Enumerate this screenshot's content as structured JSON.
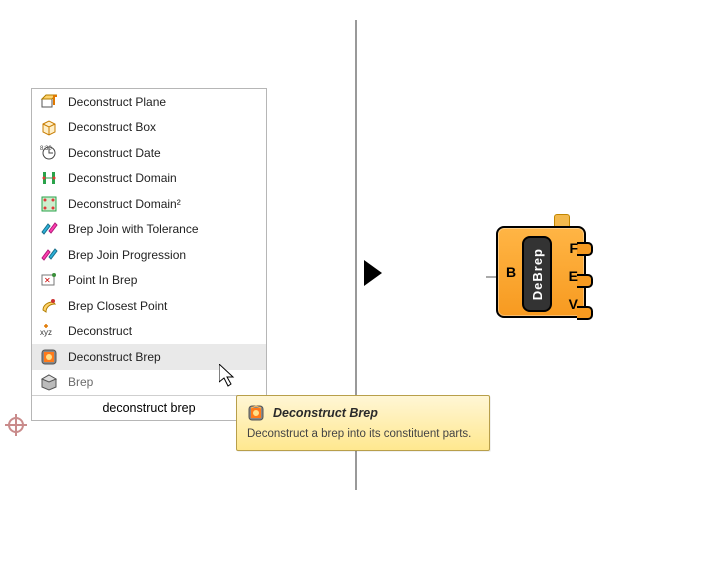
{
  "menu": {
    "items": [
      {
        "icon": "deconstruct-plane-icon",
        "label": "Deconstruct Plane"
      },
      {
        "icon": "deconstruct-box-icon",
        "label": "Deconstruct Box"
      },
      {
        "icon": "deconstruct-date-icon",
        "label": "Deconstruct Date"
      },
      {
        "icon": "deconstruct-domain-icon",
        "label": "Deconstruct Domain"
      },
      {
        "icon": "deconstruct-domain2-icon",
        "label": "Deconstruct Domain²"
      },
      {
        "icon": "brep-join-tol-icon",
        "label": "Brep Join with Tolerance"
      },
      {
        "icon": "brep-join-prog-icon",
        "label": "Brep Join Progression"
      },
      {
        "icon": "point-in-brep-icon",
        "label": "Point In Brep"
      },
      {
        "icon": "brep-closest-point-icon",
        "label": "Brep Closest Point"
      },
      {
        "icon": "deconstruct-icon",
        "label": "Deconstruct"
      },
      {
        "icon": "deconstruct-brep-icon",
        "label": "Deconstruct Brep"
      },
      {
        "icon": "brep-icon",
        "label": "Brep"
      }
    ],
    "selected_index": 10
  },
  "search": {
    "value": "deconstruct brep"
  },
  "tooltip": {
    "title": "Deconstruct Brep",
    "description": "Deconstruct a brep into its constituent parts."
  },
  "component": {
    "name": "DeBrep",
    "input": "B",
    "outputs": [
      "F",
      "E",
      "V"
    ]
  }
}
